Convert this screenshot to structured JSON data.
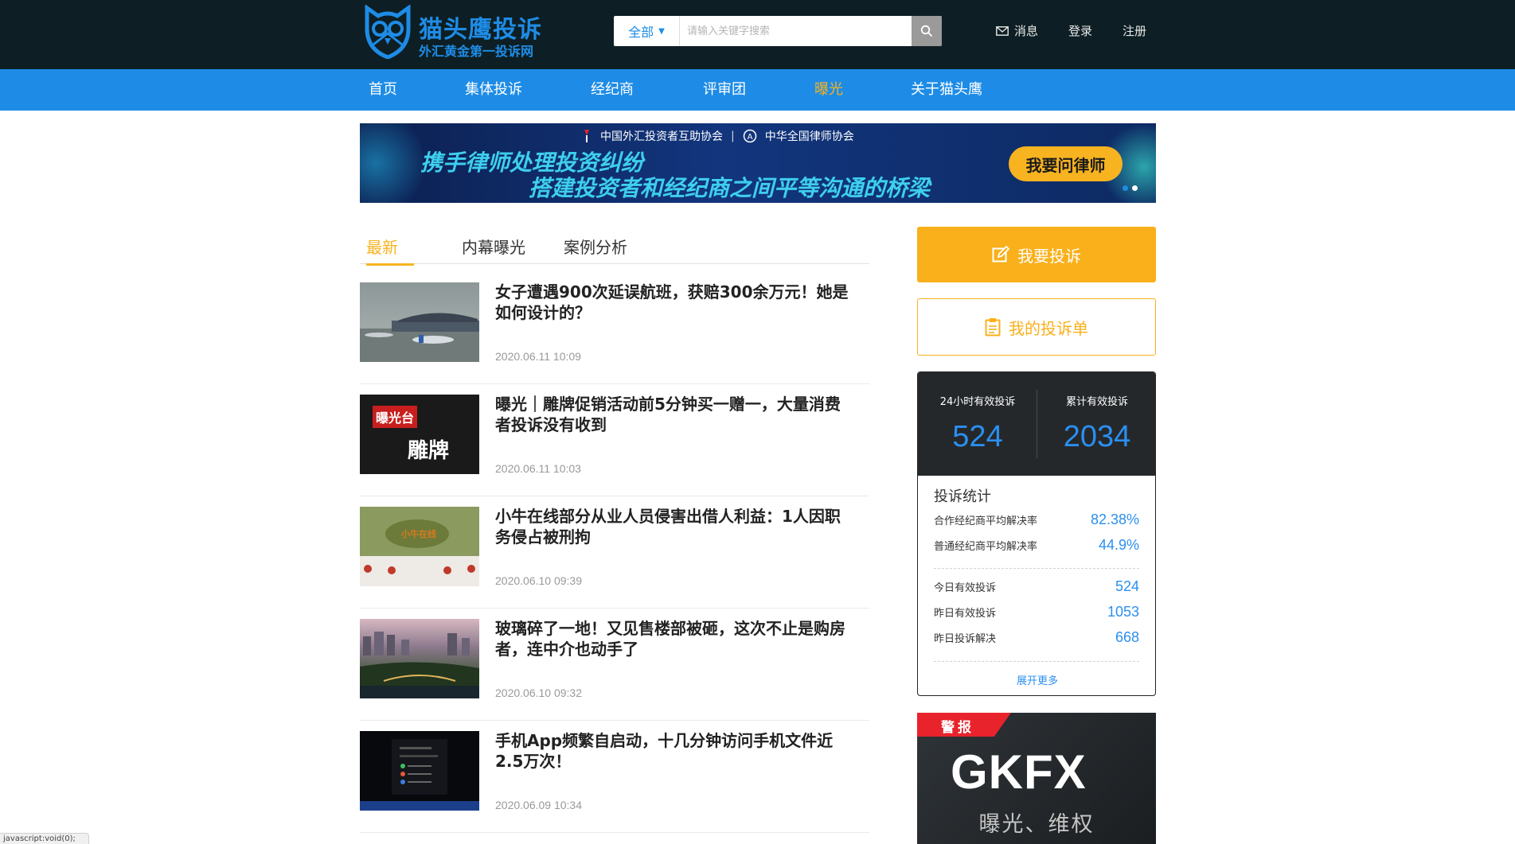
{
  "header": {
    "logo_title": "猫头鹰投诉",
    "logo_subtitle": "外汇黄金第一投诉网",
    "search": {
      "scope": "全部",
      "placeholder": "请输入关键字搜索",
      "value": ""
    },
    "links": {
      "messages": "消息",
      "login": "登录",
      "register": "注册"
    }
  },
  "nav": {
    "items": [
      "首页",
      "集体投诉",
      "经纪商",
      "评审团",
      "曝光",
      "关于猫头鹰"
    ],
    "active": "曝光"
  },
  "banner": {
    "org1": "中国外汇投资者互助协会",
    "org_sep": "|",
    "org2": "中华全国律师协会",
    "line1": "携手律师处理投资纠纷",
    "line2": "搭建投资者和经纪商之间平等沟通的桥梁",
    "button": "我要问律师",
    "slides": 2,
    "active_slide": 1
  },
  "tabs": {
    "items": [
      "最新",
      "内幕曝光",
      "案例分析"
    ],
    "active": "最新"
  },
  "news": [
    {
      "title": "女子遭遇900次延误航班，获赔300余万元！她是如何设计的？",
      "time": "2020.06.11 10:09",
      "thumb": "airport"
    },
    {
      "title": "曝光｜雕牌促销活动前5分钟买一赠一，大量消费者投诉没有收到",
      "time": "2020.06.11 10:03",
      "thumb": "diaopai",
      "thumb_text_1": "曝光台",
      "thumb_text_2": "雕牌"
    },
    {
      "title": "小牛在线部分从业人员侵害出借人利益：1人因职务侵占被刑拘",
      "time": "2020.06.10 09:39",
      "thumb": "office",
      "thumb_text_1": "小牛在线"
    },
    {
      "title": "玻璃碎了一地！又见售楼部被砸，这次不止是购房者，连中介也动手了",
      "time": "2020.06.10 09:32",
      "thumb": "city"
    },
    {
      "title": "手机App频繁自启动，十几分钟访问手机文件近2.5万次！",
      "time": "2020.06.09 10:34",
      "thumb": "phone"
    }
  ],
  "sidebar": {
    "complain_button": "我要投诉",
    "my_list_button": "我的投诉单",
    "stats": {
      "label_24h": "24小时有效投诉",
      "value_24h": "524",
      "label_total": "累计有效投诉",
      "value_total": "2034",
      "heading": "投诉统计",
      "rows_a": [
        {
          "k": "合作经纪商平均解决率",
          "v": "82.38%"
        },
        {
          "k": "普通经纪商平均解决率",
          "v": "44.9%"
        }
      ],
      "rows_b": [
        {
          "k": "今日有效投诉",
          "v": "524"
        },
        {
          "k": "昨日有效投诉",
          "v": "1053"
        },
        {
          "k": "昨日投诉解决",
          "v": "668"
        }
      ],
      "more": "展开更多"
    },
    "ad": {
      "tag": "警报",
      "logo": "GKFX",
      "subtitle": "曝光、维权"
    }
  },
  "status_bar": "javascript:void(0);",
  "colors": {
    "topbar": "#0d1f24",
    "nav": "#1e8ce6",
    "accent": "#f7b320",
    "stat_blue": "#2b8ff0"
  }
}
